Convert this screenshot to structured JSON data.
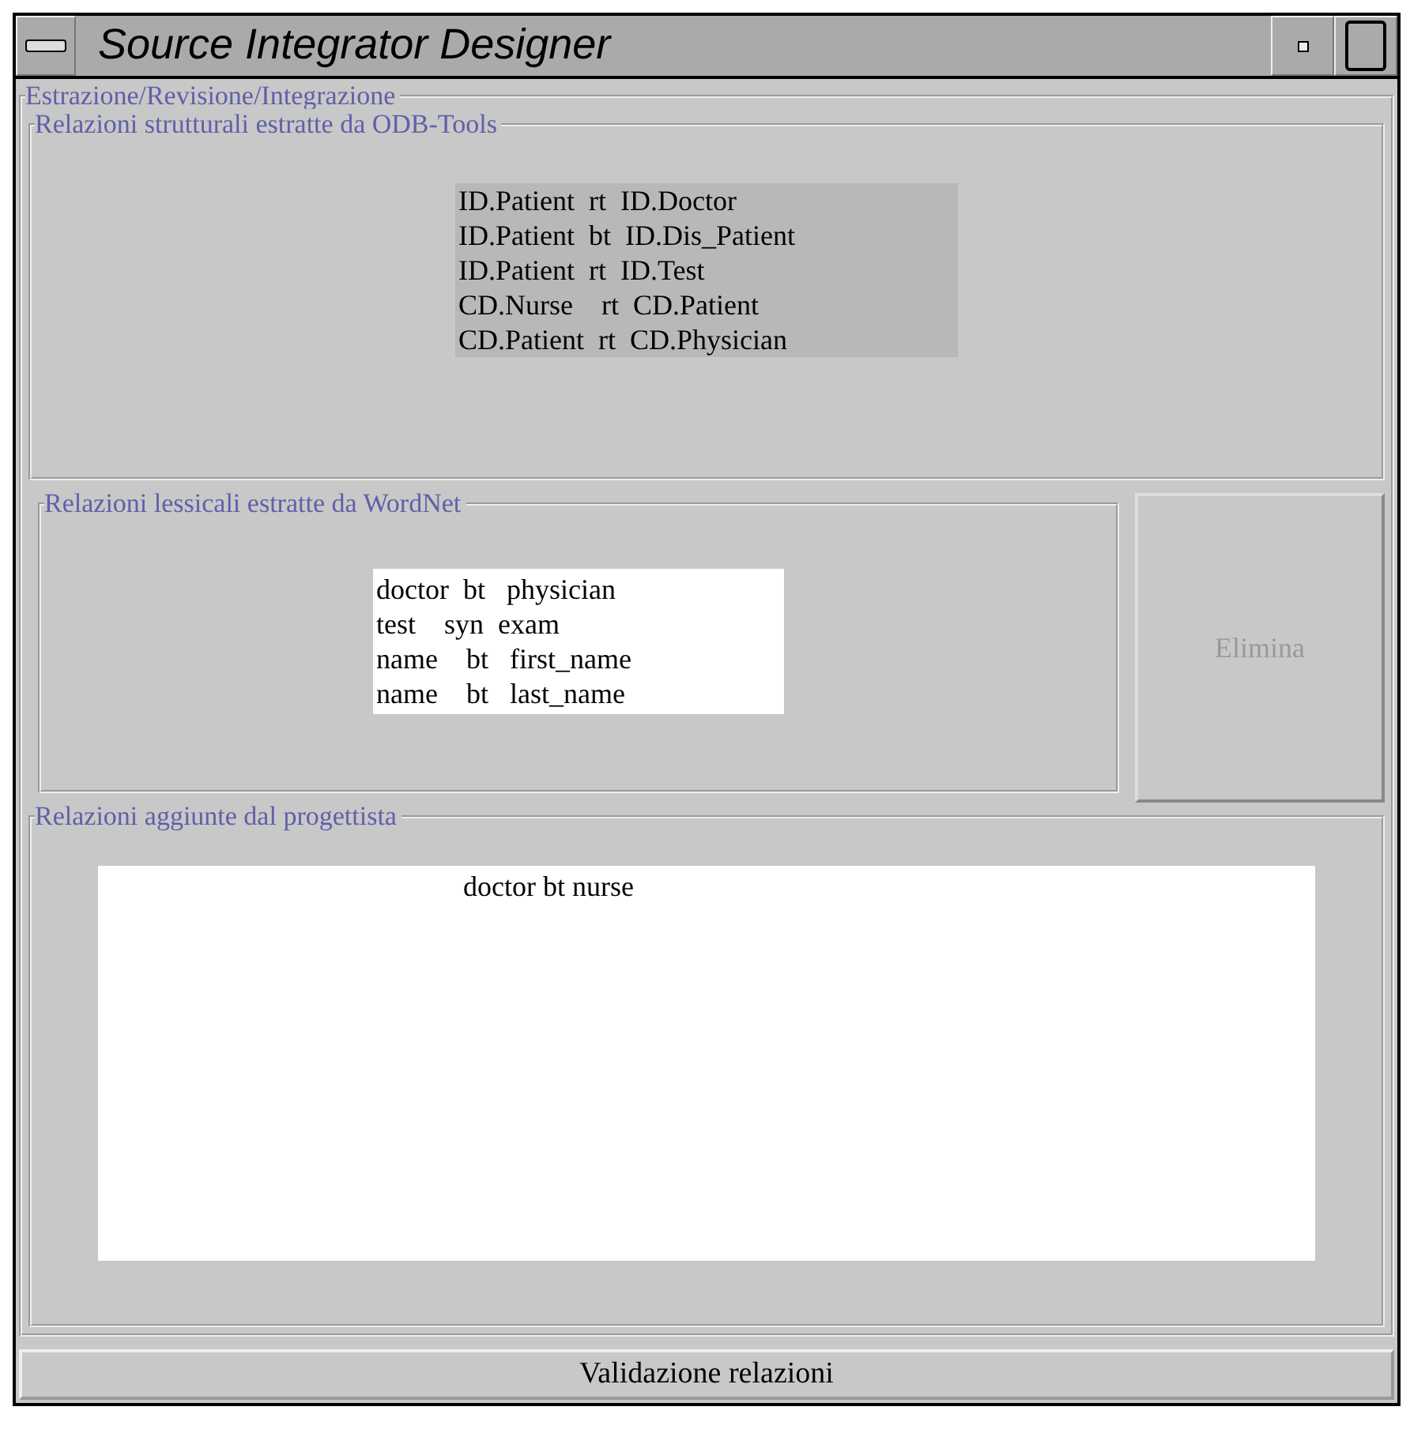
{
  "window": {
    "title": "Source Integrator Designer"
  },
  "main_group": {
    "title": "Estrazione/Revisione/Integrazione"
  },
  "structural": {
    "title": "Relazioni strutturali estratte da ODB-Tools",
    "disabled": true,
    "rows": [
      "ID.Patient  rt  ID.Doctor",
      "ID.Patient  bt  ID.Dis_Patient",
      "ID.Patient  rt  ID.Test",
      "CD.Nurse    rt  CD.Patient",
      "CD.Patient  rt  CD.Physician"
    ]
  },
  "lexical": {
    "title": "Relazioni lessicali estratte da WordNet",
    "rows": [
      "doctor  bt   physician",
      "test    syn  exam",
      "name    bt   first_name",
      "name    bt   last_name"
    ]
  },
  "delete_button": {
    "label": "Elimina",
    "disabled": true
  },
  "added": {
    "title": "Relazioni aggiunte dal progettista",
    "rows": [
      "doctor bt nurse"
    ]
  },
  "validate_button": {
    "label": "Validazione relazioni",
    "disabled": false
  }
}
